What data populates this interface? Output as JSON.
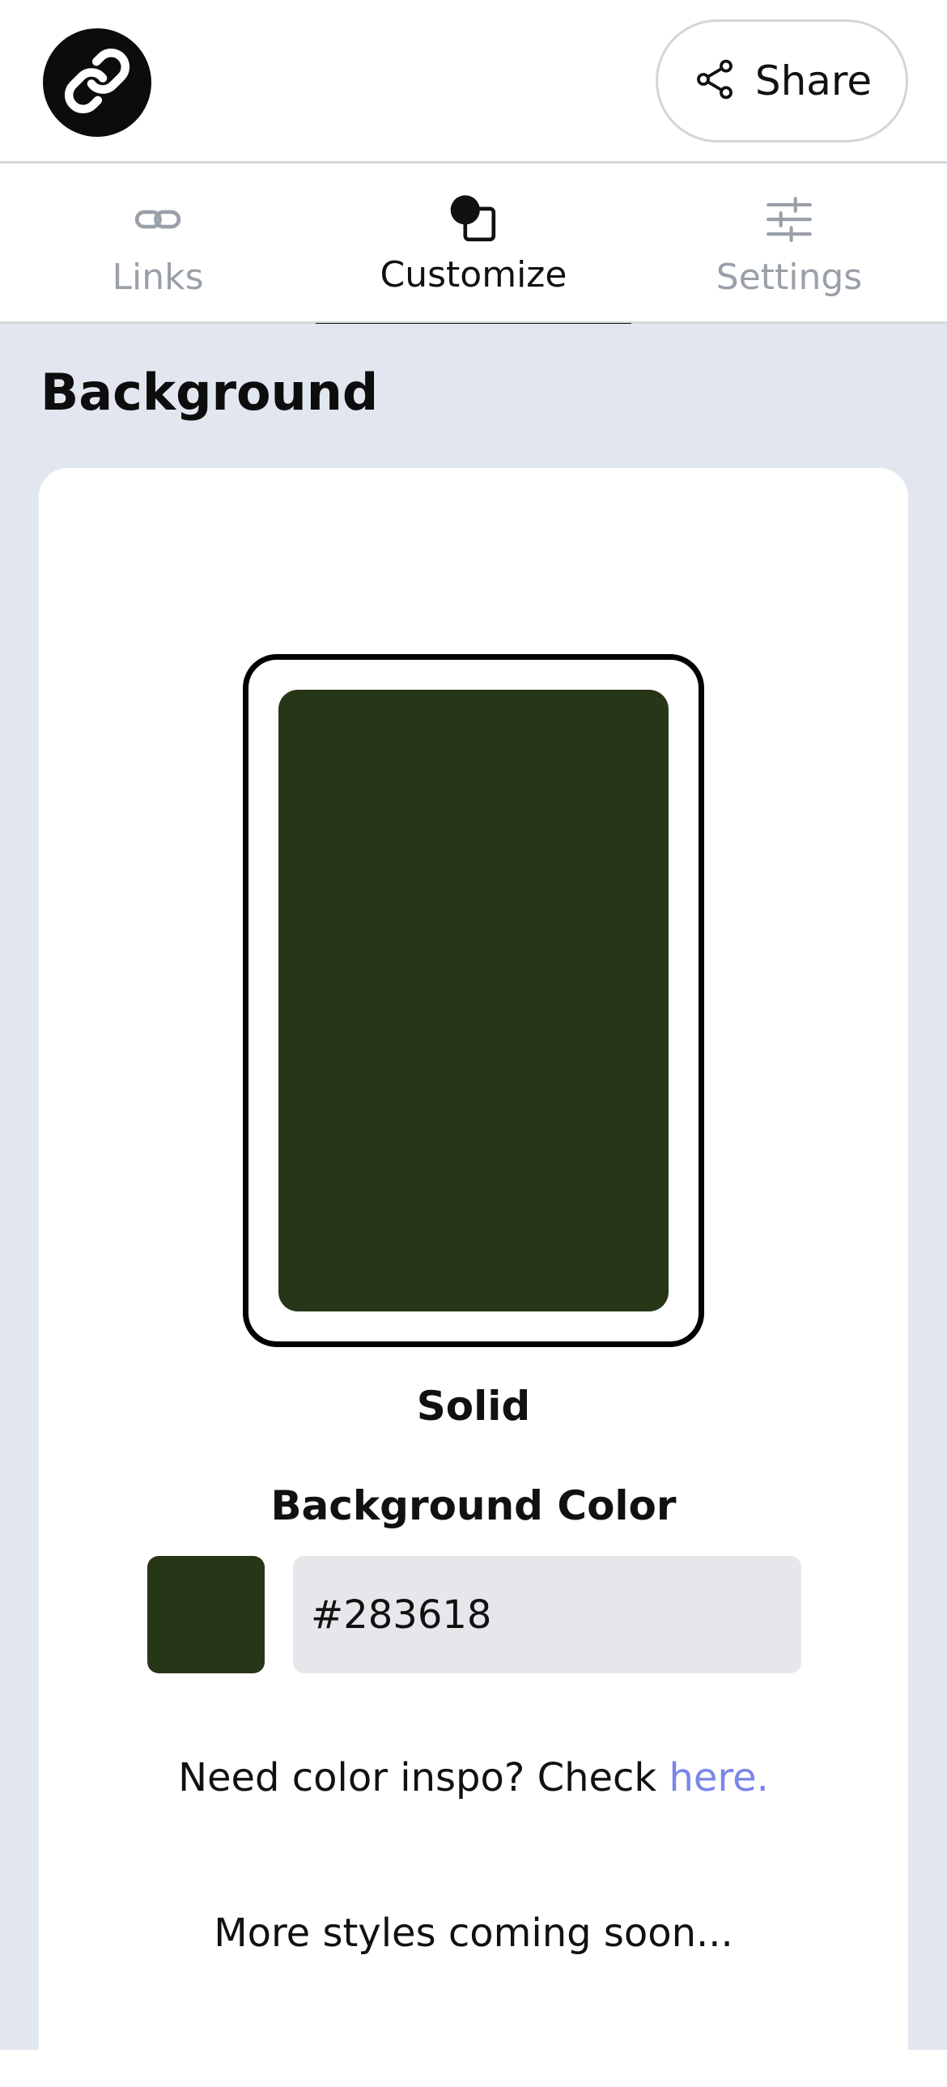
{
  "header": {
    "logo_icon": "link-icon",
    "share_label": "Share",
    "share_icon": "share-icon"
  },
  "tabs": [
    {
      "label": "Links",
      "icon": "link-icon",
      "active": false
    },
    {
      "label": "Customize",
      "icon": "palette-icon",
      "active": true
    },
    {
      "label": "Settings",
      "icon": "sliders-icon",
      "active": false
    }
  ],
  "background": {
    "title": "Background",
    "style_label": "Solid",
    "color_heading": "Background Color",
    "hex_value": "#283618",
    "swatch_color": "#283618",
    "inspo_text": "Need color inspo? Check ",
    "inspo_link": "here.",
    "coming_soon": "More styles coming soon..."
  },
  "colors": {
    "accent_link": "#7b86e8",
    "tab_inactive": "#9aa0a8",
    "page_bg": "#e2e7ef"
  }
}
